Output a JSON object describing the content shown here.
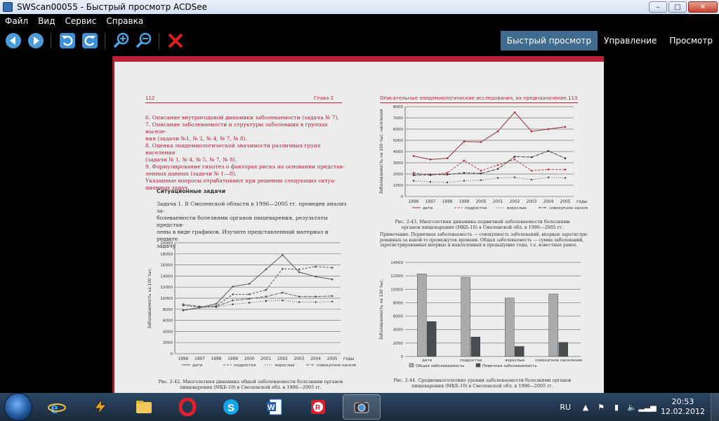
{
  "window": {
    "title": "SWScan00055 - Быстрый просмотр ACDSee",
    "controls": {
      "minimize": "–",
      "maximize": "□",
      "close": "✕"
    }
  },
  "menu": [
    "Файл",
    "Вид",
    "Сервис",
    "Справка"
  ],
  "toolbar": {
    "icons": [
      "arrow-left-icon",
      "arrow-right-icon",
      "rotate-left-icon",
      "rotate-right-icon",
      "zoom-in-icon",
      "zoom-out-icon",
      "delete-icon"
    ]
  },
  "modes": {
    "quick": "Быстрый просмотр",
    "manage": "Управление",
    "view": "Просмотр"
  },
  "document": {
    "left": {
      "page_no": "112",
      "chapter": "Глава 2",
      "list": [
        "6.  Описание внутригодовой динамики заболеваемости (задача № 7).",
        "7.  Описание заболеваемости и структуры заболевших в группах населе-",
        "     ния (задачи №1, № 2, № 4, № 7, № 8).",
        "8.  Оценка эпидемиологической значимости различных групп населения",
        "     (задачи № 1, № 4, № 5, № 7, № 8).",
        "9.  Формулирование гипотез о факторах риска на основании представ-",
        "     ленных данных (задачи № 1—8).",
        "     Указанные вопросы отрабатывают при решении следующих ситуа-",
        "     ционных задач."
      ],
      "section": "Ситуационные задачи",
      "task": [
        "Задача 1. В Смоленской области в 1996—2005 гг. проведен анализ за-",
        "болеваемости болезнями органов пищеварения, результаты представ-",
        "лены в виде графиков. Изучите представленный материал и решите",
        "задачу"
      ],
      "caption": [
        "Рис. 2-42. Многолетняя динамика общей заболеваемости болезнями органов",
        "пищеварения (МКБ-10) в Смоленской обл. в 1996—2005 гг."
      ]
    },
    "right": {
      "running_head": "Описательные эпидемиологические исследования, их предназначение...",
      "page_no": "113",
      "caption43": [
        "Рис. 2-43. Многолетняя динамика первичной заболеваемости болезнями",
        "органов пищеварения (МКБ-10) в Смоленской обл. в 1996—2005 гг."
      ],
      "note": [
        "Примечание. Первичная заболеваемость — совокупность заболеваний, впервые зарегистри-",
        "рованных за какой-то промежуток времени. Общая заболеваемость — сумма заболеваний,",
        "зарегистрированных впервые и накопленных в предыдущие годы, т.е. известных ранее."
      ],
      "caption44": [
        "Рис. 2-44. Среднемноголетние уровни заболеваемости болезнями органов",
        "пищеварения (МКБ-10) в Смоленской обл. в 1996—2005 гг."
      ]
    }
  },
  "chart_data": [
    {
      "type": "line",
      "ylabel": "Заболеваемость на 100 тыс.",
      "xlabel": "годы",
      "ylim": [
        0,
        20000
      ],
      "yticks": [
        0,
        2000,
        4000,
        6000,
        8000,
        10000,
        12000,
        14000,
        16000,
        18000,
        20000
      ],
      "x": [
        "1996",
        "1997",
        "1998",
        "1999",
        "2000",
        "2001",
        "2002",
        "2003",
        "2004",
        "2005"
      ],
      "series": [
        {
          "name": "дети",
          "values": [
            7800,
            8300,
            9000,
            12100,
            12600,
            15200,
            17800,
            14700,
            13900,
            13400
          ],
          "color": "#555",
          "dash": ""
        },
        {
          "name": "подростки",
          "values": [
            8700,
            8400,
            8600,
            10700,
            10700,
            11500,
            15300,
            15200,
            15700,
            15500
          ],
          "color": "#555",
          "dash": "3,2"
        },
        {
          "name": "взрослые",
          "values": [
            7900,
            8300,
            8400,
            8900,
            9200,
            9500,
            9600,
            9300,
            9300,
            9400
          ],
          "color": "#555",
          "dash": "1,2"
        },
        {
          "name": "совокупное население",
          "values": [
            8900,
            8500,
            8500,
            9600,
            9900,
            10300,
            11000,
            10300,
            10300,
            10400
          ],
          "color": "#555",
          "dash": "4,1,1,1"
        }
      ]
    },
    {
      "type": "line",
      "ylabel": "Заболеваемость на 100 тыс. населения",
      "xlabel": "годы",
      "ylim": [
        0,
        8000
      ],
      "yticks": [
        0,
        1000,
        2000,
        3000,
        4000,
        5000,
        6000,
        7000,
        8000
      ],
      "x": [
        "1996",
        "1997",
        "1998",
        "1999",
        "2000",
        "2001",
        "2002",
        "2003",
        "2004",
        "2005"
      ],
      "series": [
        {
          "name": "дети",
          "values": [
            3600,
            3300,
            3400,
            4900,
            4850,
            5800,
            7500,
            5800,
            6000,
            6200
          ],
          "color": "#9b2f40",
          "dash": ""
        },
        {
          "name": "подростки",
          "values": [
            2100,
            1900,
            2100,
            3200,
            2300,
            2800,
            3300,
            2300,
            2400,
            2400
          ],
          "color": "#c0394d",
          "dash": "3,2"
        },
        {
          "name": "взрослые",
          "values": [
            1400,
            1300,
            1250,
            1400,
            1450,
            1650,
            1700,
            1500,
            1700,
            1650
          ],
          "color": "#555",
          "dash": "1,2"
        },
        {
          "name": "совокупное население",
          "values": [
            1900,
            1950,
            1950,
            2100,
            2050,
            2450,
            3550,
            3500,
            4050,
            3400
          ],
          "color": "#333",
          "dash": "4,1,1,1"
        }
      ]
    },
    {
      "type": "bar",
      "ylabel": "Заболеваемость на 100 тыс.",
      "ylim": [
        0,
        14000
      ],
      "yticks": [
        0,
        2000,
        4000,
        6000,
        8000,
        10000,
        12000,
        14000
      ],
      "categories": [
        "дети",
        "подростки",
        "взрослые",
        "совокупное население"
      ],
      "series": [
        {
          "name": "Общая заболеваемость",
          "values": [
            12300,
            11800,
            8700,
            9300
          ],
          "color": "#a9abad"
        },
        {
          "name": "Певичная заболеваемость",
          "values": [
            5200,
            2900,
            1500,
            2100
          ],
          "color": "#4a4d4f"
        }
      ]
    }
  ],
  "taskbar": {
    "apps": [
      "internet-explorer-icon",
      "winamp-icon",
      "file-explorer-icon",
      "opera-icon",
      "skype-icon",
      "word-icon",
      "foxit-reader-icon",
      "acdsee-icon"
    ]
  },
  "tray": {
    "lang": "RU",
    "time": "20:53",
    "date": "12.02.2012"
  }
}
